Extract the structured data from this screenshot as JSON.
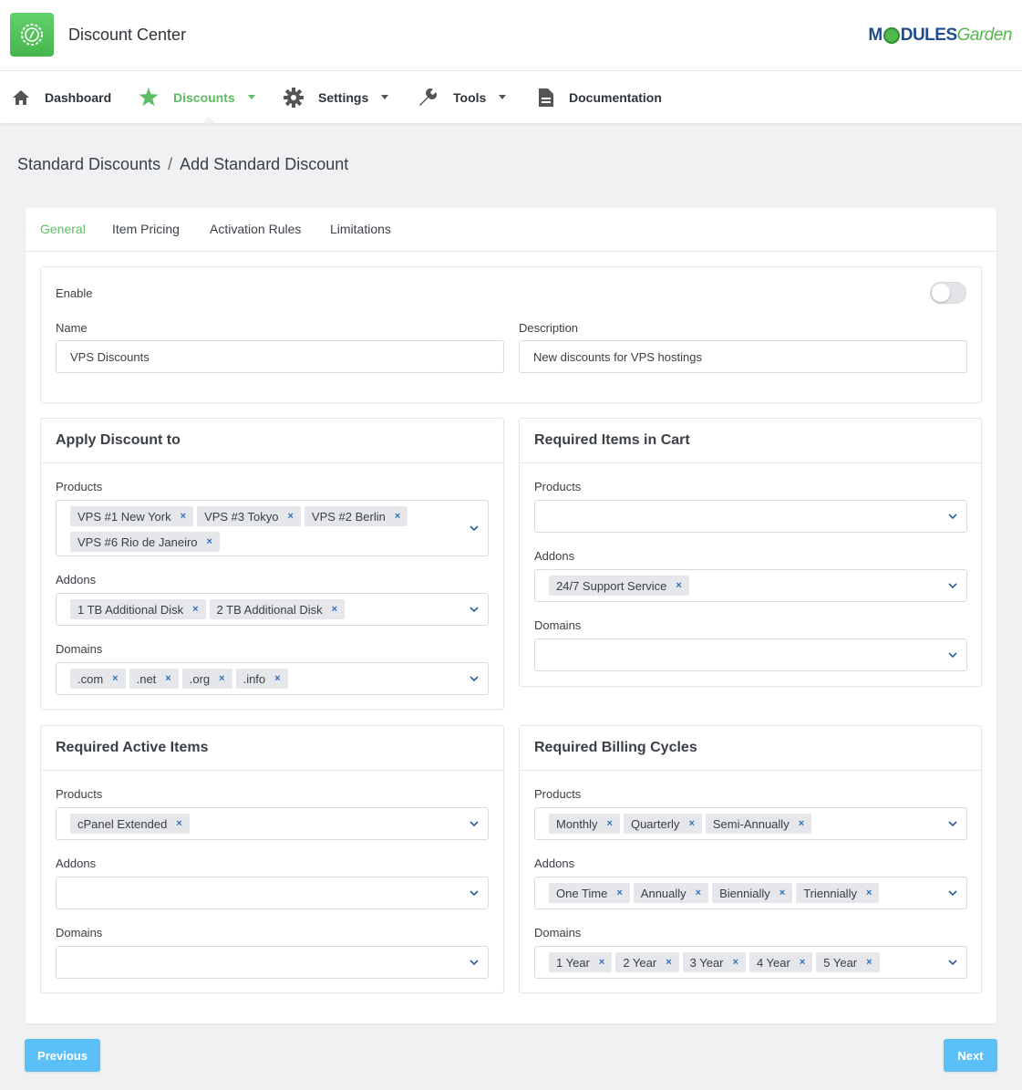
{
  "app": {
    "title": "Discount Center",
    "brand_part1": "M",
    "brand_part2": "DULES",
    "brand_part3": "Garden"
  },
  "nav": {
    "dashboard": "Dashboard",
    "discounts": "Discounts",
    "settings": "Settings",
    "tools": "Tools",
    "documentation": "Documentation"
  },
  "breadcrumb": {
    "parent": "Standard Discounts",
    "separator": "/",
    "current": "Add Standard Discount"
  },
  "tabs": {
    "general": "General",
    "item_pricing": "Item Pricing",
    "activation_rules": "Activation Rules",
    "limitations": "Limitations"
  },
  "general": {
    "enable_label": "Enable",
    "enabled": false,
    "name_label": "Name",
    "name_value": "VPS Discounts",
    "description_label": "Description",
    "description_value": "New discounts for VPS hostings"
  },
  "apply_discount": {
    "title": "Apply Discount to",
    "products_label": "Products",
    "products": [
      "VPS #1 New York",
      "VPS #3 Tokyo",
      "VPS #2 Berlin",
      "VPS #6 Rio de Janeiro"
    ],
    "addons_label": "Addons",
    "addons": [
      "1 TB Additional Disk",
      "2 TB Additional Disk"
    ],
    "domains_label": "Domains",
    "domains": [
      ".com",
      ".net",
      ".org",
      ".info"
    ]
  },
  "required_cart": {
    "title": "Required Items in Cart",
    "products_label": "Products",
    "addons_label": "Addons",
    "addons": [
      "24/7 Support Service"
    ],
    "domains_label": "Domains"
  },
  "required_active": {
    "title": "Required Active Items",
    "products_label": "Products",
    "products": [
      "cPanel Extended"
    ],
    "addons_label": "Addons",
    "domains_label": "Domains"
  },
  "billing_cycles": {
    "title": "Required Billing Cycles",
    "products_label": "Products",
    "products": [
      "Monthly",
      "Quarterly",
      "Semi-Annually"
    ],
    "addons_label": "Addons",
    "addons": [
      "One Time",
      "Annually",
      "Biennially",
      "Triennially"
    ],
    "domains_label": "Domains",
    "domains": [
      "1 Year",
      "2 Year",
      "3 Year",
      "4 Year",
      "5 Year"
    ]
  },
  "buttons": {
    "previous": "Previous",
    "next": "Next"
  },
  "chip_remove_glyph": "×",
  "colors": {
    "accent": "#5cbc63",
    "button": "#5bc0f8",
    "chip_x": "#2c6fbe"
  }
}
